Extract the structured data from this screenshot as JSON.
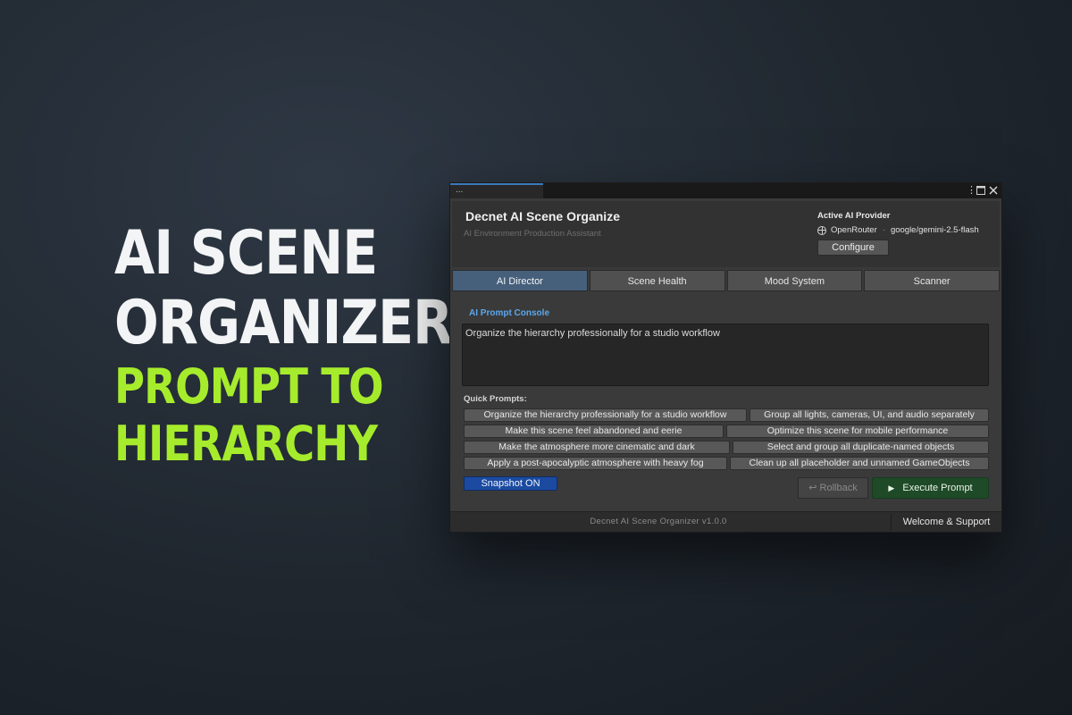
{
  "hero": {
    "line1": "AI SCENE",
    "line2": "ORGANIZER",
    "line3": "PROMPT TO",
    "line4": "HIERARCHY"
  },
  "window": {
    "tab_label": "...",
    "title": "Decnet AI Scene Organize",
    "subtitle": "AI Environment Production Assistant",
    "provider": {
      "label": "Active AI Provider",
      "name": "OpenRouter",
      "separator": "·",
      "model": "google/gemini-2.5-flash",
      "configure_label": "Configure"
    },
    "tabs": [
      {
        "label": "AI Director"
      },
      {
        "label": "Scene Health"
      },
      {
        "label": "Mood System"
      },
      {
        "label": "Scanner"
      }
    ],
    "console": {
      "label": "AI Prompt Console",
      "value": "Organize the hierarchy professionally for a studio workflow"
    },
    "quick_prompts": {
      "label": "Quick Prompts:",
      "items": [
        "Organize the hierarchy professionally for a studio workflow",
        "Group all lights, cameras, UI, and audio separately",
        "Make this scene feel abandoned and eerie",
        "Optimize this scene for mobile performance",
        "Make the atmosphere more cinematic and dark",
        "Select and group all duplicate-named objects",
        "Apply a post-apocalyptic atmosphere with heavy fog",
        "Clean up all placeholder and unnamed GameObjects"
      ]
    },
    "snapshot_label": "Snapshot ON",
    "rollback_label": "Rollback",
    "execute_label": "Execute Prompt",
    "footer": {
      "version": "Decnet AI Scene Organizer  v1.0.0",
      "welcome_label": "Welcome & Support"
    }
  }
}
